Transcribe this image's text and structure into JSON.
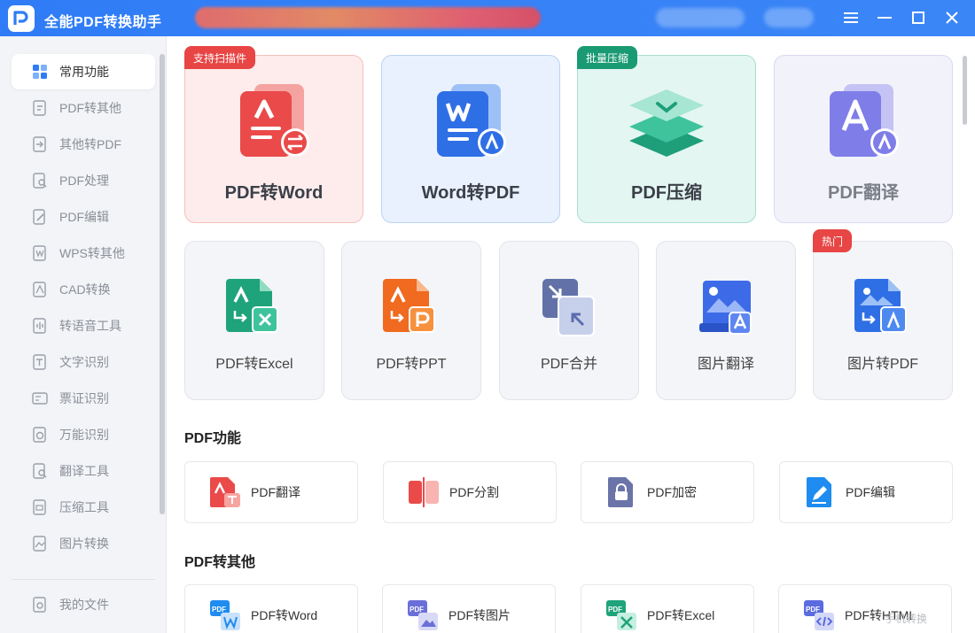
{
  "window": {
    "title": "全能PDF转换助手",
    "accent": "#2f7cf6"
  },
  "sidebar": {
    "items": [
      {
        "label": "常用功能",
        "icon": "grid-icon",
        "active": true
      },
      {
        "label": "PDF转其他",
        "icon": "pdf-export-icon"
      },
      {
        "label": "其他转PDF",
        "icon": "pdf-import-icon"
      },
      {
        "label": "PDF处理",
        "icon": "pdf-search-icon"
      },
      {
        "label": "PDF编辑",
        "icon": "pdf-edit-icon"
      },
      {
        "label": "WPS转其他",
        "icon": "wps-convert-icon"
      },
      {
        "label": "CAD转换",
        "icon": "cad-icon"
      },
      {
        "label": "转语音工具",
        "icon": "speech-icon"
      },
      {
        "label": "文字识别",
        "icon": "ocr-text-icon"
      },
      {
        "label": "票证识别",
        "icon": "ticket-icon"
      },
      {
        "label": "万能识别",
        "icon": "universal-recognize-icon"
      },
      {
        "label": "翻译工具",
        "icon": "translate-icon"
      },
      {
        "label": "压缩工具",
        "icon": "compress-icon"
      },
      {
        "label": "图片转换",
        "icon": "image-convert-icon"
      }
    ],
    "files": {
      "label": "我的文件",
      "icon": "my-files-icon"
    }
  },
  "featured": [
    {
      "label": "PDF转Word",
      "tag": "支持扫描件",
      "icon": "pdf-to-word-icon",
      "bg": "#fdeceb",
      "border": "#f4c1bd"
    },
    {
      "label": "Word转PDF",
      "tag": "",
      "icon": "word-to-pdf-icon",
      "bg": "#e8f1fd",
      "border": "#bcd3f3"
    },
    {
      "label": "PDF压缩",
      "tag": "批量压缩",
      "icon": "pdf-compress-icon",
      "bg": "#e4f6f1",
      "border": "#a9dfcf"
    },
    {
      "label": "PDF翻译",
      "tag": "",
      "icon": "pdf-translate-icon",
      "bg": "#f2f2fb",
      "border": "#d9daf1"
    }
  ],
  "tools": [
    {
      "label": "PDF转Excel",
      "icon": "pdf-to-excel-icon",
      "tag": ""
    },
    {
      "label": "PDF转PPT",
      "icon": "pdf-to-ppt-icon",
      "tag": ""
    },
    {
      "label": "PDF合并",
      "icon": "pdf-merge-icon",
      "tag": ""
    },
    {
      "label": "图片翻译",
      "icon": "image-translate-icon",
      "tag": ""
    },
    {
      "label": "图片转PDF",
      "icon": "image-to-pdf-icon",
      "tag": "热门"
    }
  ],
  "sections": [
    {
      "title": "PDF功能",
      "items": [
        {
          "label": "PDF翻译",
          "icon": "pdf-translate-small-icon"
        },
        {
          "label": "PDF分割",
          "icon": "pdf-split-icon"
        },
        {
          "label": "PDF加密",
          "icon": "pdf-encrypt-icon"
        },
        {
          "label": "PDF编辑",
          "icon": "pdf-edit-small-icon"
        }
      ]
    },
    {
      "title": "PDF转其他",
      "items": [
        {
          "label": "PDF转Word",
          "icon": "pdf-word-small-icon"
        },
        {
          "label": "PDF转图片",
          "icon": "pdf-image-small-icon"
        },
        {
          "label": "PDF转Excel",
          "icon": "pdf-excel-small-icon"
        },
        {
          "label": "PDF转HTML",
          "icon": "pdf-html-small-icon"
        }
      ]
    }
  ],
  "watermark": "手机转换"
}
